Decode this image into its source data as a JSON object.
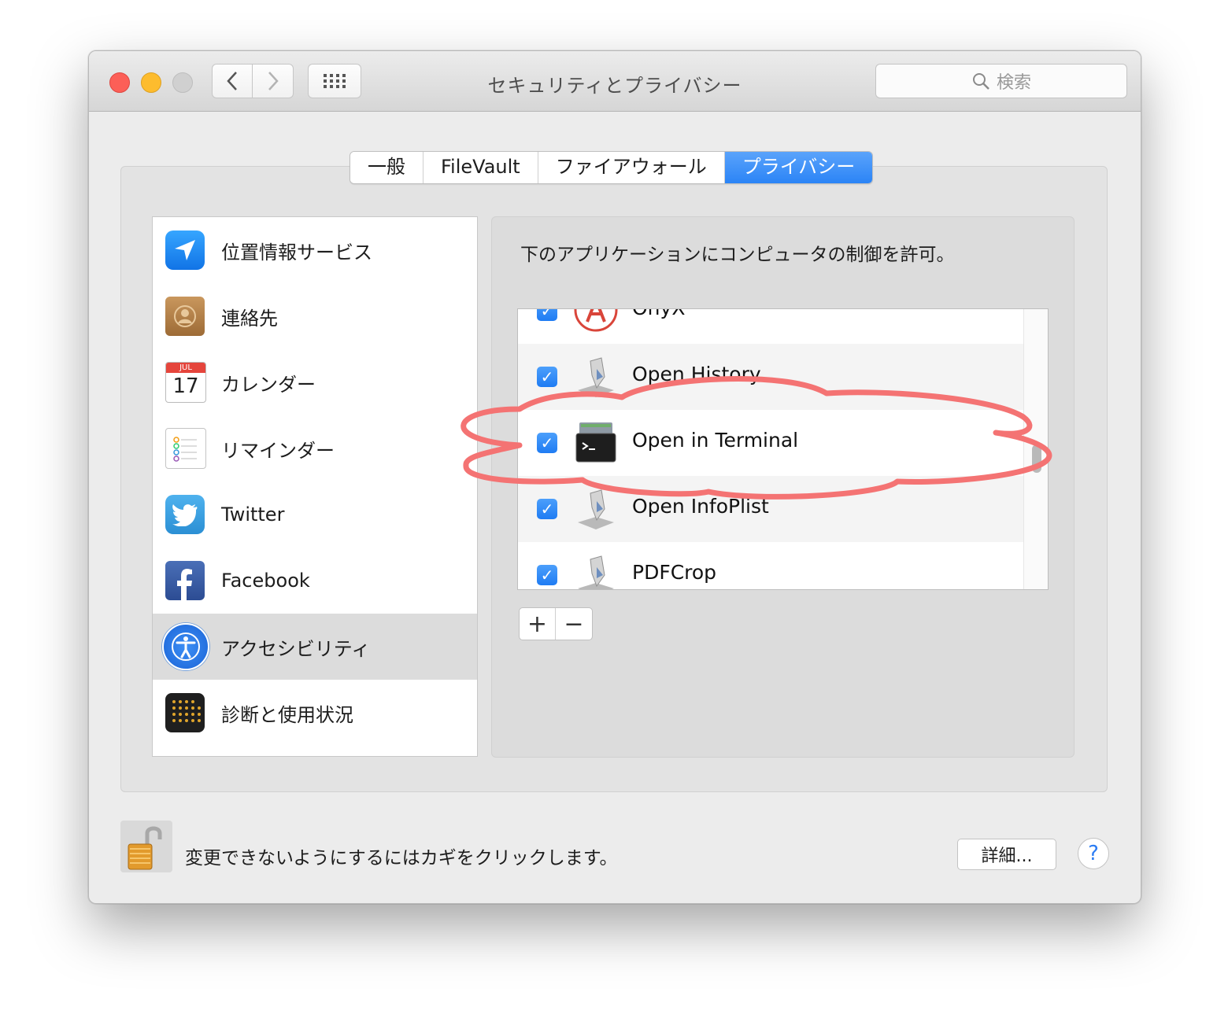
{
  "window": {
    "title": "セキュリティとプライバシー",
    "search_placeholder": "検索"
  },
  "tabs": [
    {
      "label": "一般",
      "active": false
    },
    {
      "label": "FileVault",
      "active": false
    },
    {
      "label": "ファイアウォール",
      "active": false
    },
    {
      "label": "プライバシー",
      "active": true
    }
  ],
  "categories": [
    {
      "label": "位置情報サービス",
      "icon": "location-icon"
    },
    {
      "label": "連絡先",
      "icon": "contacts-icon"
    },
    {
      "label": "カレンダー",
      "icon": "calendar-icon",
      "icon_month": "JUL",
      "icon_day": "17"
    },
    {
      "label": "リマインダー",
      "icon": "reminders-icon"
    },
    {
      "label": "Twitter",
      "icon": "twitter-icon"
    },
    {
      "label": "Facebook",
      "icon": "facebook-icon"
    },
    {
      "label": "アクセシビリティ",
      "icon": "accessibility-icon",
      "selected": true
    },
    {
      "label": "診断と使用状況",
      "icon": "diagnostics-icon"
    }
  ],
  "panel": {
    "description": "下のアプリケーションにコンピュータの制御を許可。",
    "apps": [
      {
        "name": "OnyX",
        "checked": true,
        "icon": "onyx-icon"
      },
      {
        "name": "Open History",
        "checked": true,
        "icon": "automator-script-icon"
      },
      {
        "name": "Open in Terminal",
        "checked": true,
        "icon": "terminal-icon"
      },
      {
        "name": "Open InfoPlist",
        "checked": true,
        "icon": "automator-script-icon"
      },
      {
        "name": "PDFCrop",
        "checked": true,
        "icon": "automator-script-icon"
      }
    ],
    "add_label": "+",
    "remove_label": "−"
  },
  "footer": {
    "lock_text": "変更できないようにするにはカギをクリックします。",
    "advanced_label": "詳細...",
    "help_label": "?"
  },
  "colors": {
    "accent": "#2b84f6",
    "annotation": "#f47373",
    "close": "#fc5f57",
    "minimize": "#fdbc2e"
  }
}
